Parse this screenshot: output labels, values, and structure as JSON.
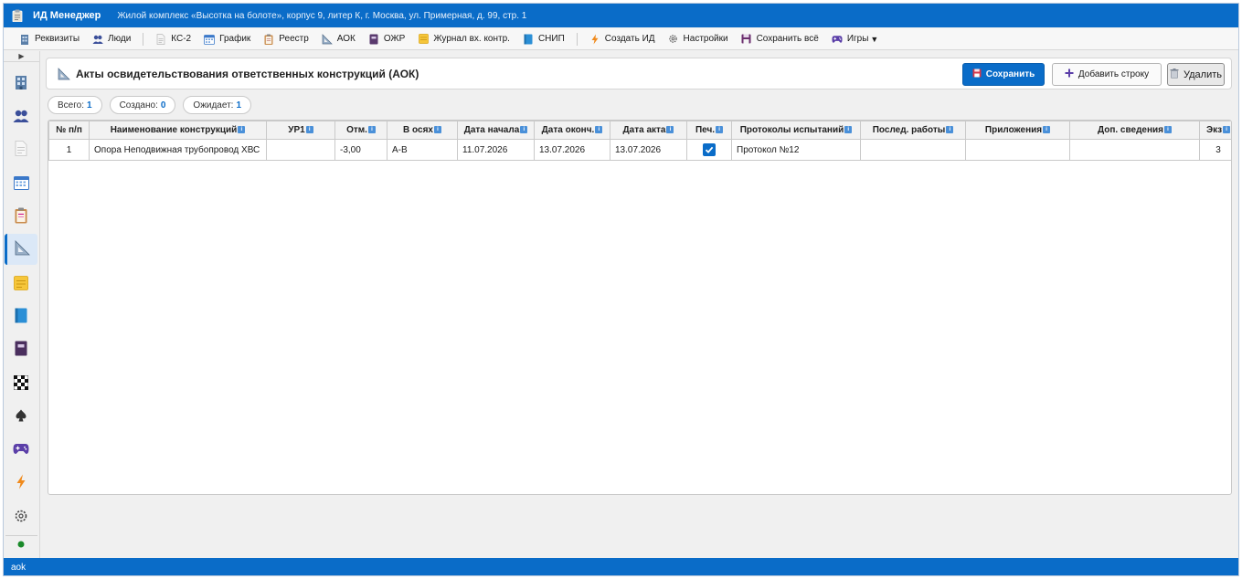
{
  "window": {
    "app_title": "ИД Менеджер",
    "project": "Жилой комплекс «Высотка на болоте», корпус 9, литер К, г. Москва, ул. Примерная, д. 99, стр. 1"
  },
  "toolbar": {
    "items": [
      {
        "label": "Реквизиты",
        "icon": "building-icon"
      },
      {
        "label": "Люди",
        "icon": "people-icon"
      },
      {
        "label": "КС-2",
        "icon": "document-icon"
      },
      {
        "label": "График",
        "icon": "calendar-icon"
      },
      {
        "label": "Реестр",
        "icon": "clipboard-icon"
      },
      {
        "label": "АОК",
        "icon": "triangle-ruler-icon"
      },
      {
        "label": "ОЖР",
        "icon": "notebook-icon"
      },
      {
        "label": "Журнал вх. контр.",
        "icon": "note-icon"
      },
      {
        "label": "СНИП",
        "icon": "book-icon"
      },
      {
        "label": "Создать ИД",
        "icon": "lightning-icon"
      },
      {
        "label": "Настройки",
        "icon": "gear-icon"
      },
      {
        "label": "Сохранить всё",
        "icon": "save-icon"
      },
      {
        "label": "Игры",
        "icon": "gamepad-icon",
        "dropdown": "▼"
      }
    ]
  },
  "sidebar": {
    "toggle": "▶",
    "items": [
      {
        "icon": "building-icon"
      },
      {
        "icon": "people-icon"
      },
      {
        "icon": "document-icon"
      },
      {
        "icon": "calendar-icon"
      },
      {
        "icon": "clipboard-icon"
      },
      {
        "icon": "triangle-ruler-icon",
        "active": true
      },
      {
        "icon": "note-icon"
      },
      {
        "icon": "book-icon"
      },
      {
        "icon": "notebook-icon"
      },
      {
        "icon": "checkerboard-icon"
      },
      {
        "icon": "spade-icon"
      },
      {
        "icon": "gamepad-icon"
      },
      {
        "icon": "lightning-icon"
      },
      {
        "icon": "gear-icon"
      }
    ],
    "status_dot_color": "#1a8a2a"
  },
  "page": {
    "title": "Акты освидетельствования ответственных конструкций (АОК)",
    "save_label": "Сохранить",
    "add_row_label": "Добавить строку",
    "delete_label": "Удалить"
  },
  "stats": {
    "total_label": "Всего:",
    "total": "1",
    "created_label": "Создано:",
    "created": "0",
    "pending_label": "Ожидает:",
    "pending": "1"
  },
  "table": {
    "columns": [
      {
        "label": "№ п/п",
        "info": false
      },
      {
        "label": "Наименование конструкций",
        "info": true
      },
      {
        "label": "УР1",
        "info": true
      },
      {
        "label": "Отм.",
        "info": true
      },
      {
        "label": "В осях",
        "info": true
      },
      {
        "label": "Дата начала",
        "info": true
      },
      {
        "label": "Дата оконч.",
        "info": true
      },
      {
        "label": "Дата акта",
        "info": true
      },
      {
        "label": "Печ.",
        "info": true
      },
      {
        "label": "Протоколы испытаний",
        "info": true
      },
      {
        "label": "Послед. работы",
        "info": true
      },
      {
        "label": "Приложения",
        "info": true
      },
      {
        "label": "Доп. сведения",
        "info": true
      },
      {
        "label": "Экз",
        "info": true
      }
    ],
    "rows": [
      {
        "num": "1",
        "name": "Опора Неподвижная трубопровод ХВС",
        "ur1": "",
        "otm": "-3,00",
        "axes": "А-В",
        "date_start": "11.07.2026",
        "date_end": "13.07.2026",
        "date_act": "13.07.2026",
        "print": true,
        "protocols": "Протокол №12",
        "next_works": "",
        "attachments": "",
        "extra": "",
        "copies": "3"
      }
    ]
  },
  "statusbar": {
    "text": "aok"
  },
  "colors": {
    "accent": "#0a6cc8",
    "info_badge": "#4a90d9"
  }
}
